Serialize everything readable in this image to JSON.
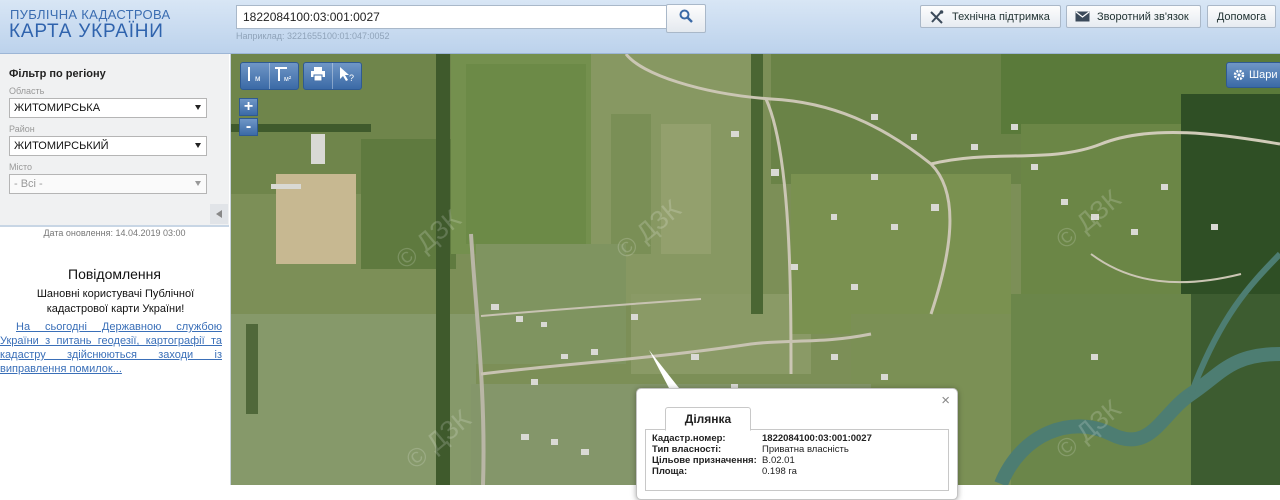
{
  "header": {
    "logo_top": "ПУБЛІЧНА КАДАСТРОВА",
    "logo_main": "КАРТА УКРАЇНИ",
    "search_value": "1822084100:03:001:0027",
    "search_hint": "Наприклад: 3221655100:01:047:0052",
    "buttons": {
      "support": "Технічна підтримка",
      "feedback": "Зворотний зв'язок",
      "help": "Допомога"
    }
  },
  "sidebar": {
    "filter_title": "Фільтр по регіону",
    "region_label": "Область",
    "region_value": "ЖИТОМИРСЬКА",
    "district_label": "Район",
    "district_value": "ЖИТОМИРСЬКИЙ",
    "city_label": "Місто",
    "city_value": "- Всі -",
    "update_date": "Дата оновлення: 14.04.2019 03:00",
    "notice_title": "Повідомлення",
    "notice_text": "Шановні користувачі Публічної кадастрової карти України!",
    "notice_link": "На сьогодні Державною службою України з питань геодезії, картографії та кадастру здійснюються заходи із виправлення помилок..."
  },
  "map": {
    "tools": [
      "ruler-m-icon",
      "area-m-icon",
      "print-icon",
      "identify-icon"
    ],
    "tool_labels": [
      "м",
      "м²"
    ],
    "zoom_in": "+",
    "zoom_out": "-",
    "layers_label": "Шари",
    "watermark": "© ДЗК"
  },
  "popup": {
    "tab": "Ділянка",
    "close": "×",
    "rows": [
      {
        "key": "Кадастр.номер:",
        "value": "1822084100:03:001:0027"
      },
      {
        "key": "Тип власності:",
        "value": "Приватна власність"
      },
      {
        "key": "Цільове призначення:",
        "value": "В.02.01"
      },
      {
        "key": "Площа:",
        "value": "0.198 га"
      }
    ]
  },
  "colors": {
    "header_blue": "#2f63ad",
    "tool_blue": "#3b6aa6",
    "link_blue": "#3a6fb8"
  }
}
